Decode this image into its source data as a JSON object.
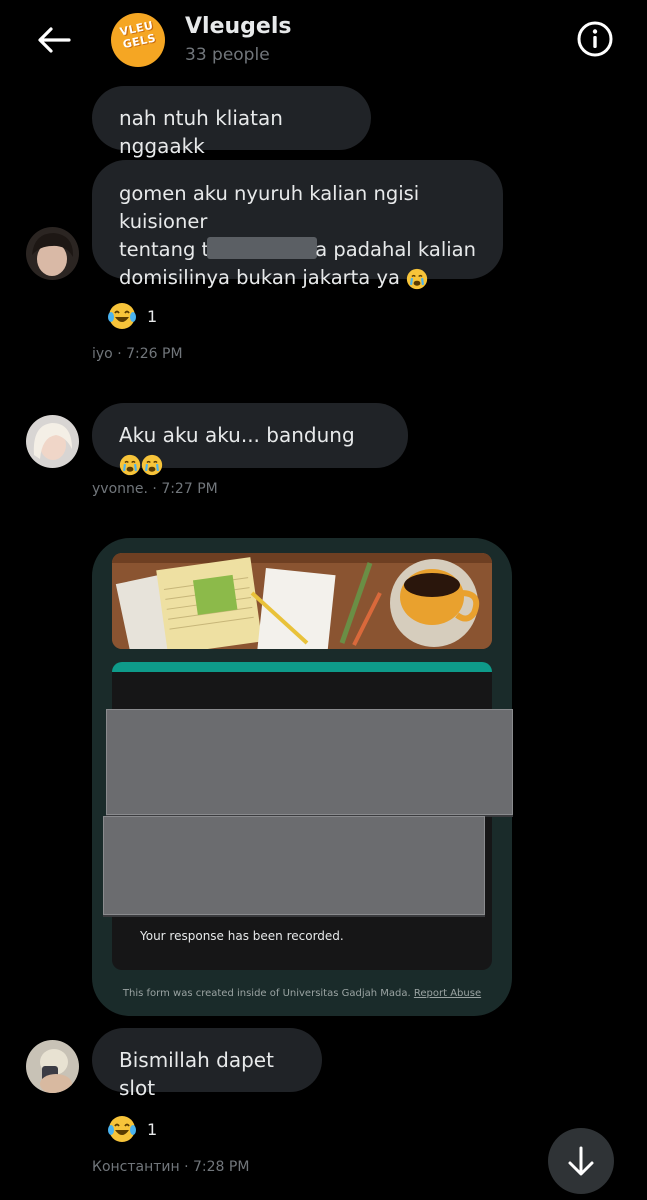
{
  "header": {
    "group_name": "Vleugels",
    "member_count": "33 people",
    "logo_text": "VLEU GELS"
  },
  "messages": [
    {
      "text": "nah ntuh kliatan nggaakk"
    },
    {
      "text_part1": "gomen aku nyuruh kalian ngisi kuisioner",
      "text_part2a": "tentang t",
      "text_part2b": "a padahal kalian",
      "text_part3": "domisilinya bukan jakarta ya",
      "reaction_count": "1",
      "sender": "iyo",
      "time": "7:26 PM"
    },
    {
      "text": "Aku aku aku... bandung",
      "sender": "yvonne.",
      "time": "7:27 PM"
    },
    {
      "text": "Bismillah dapet slot",
      "reaction_count": "1",
      "sender": "Константин",
      "time": "7:28 PM"
    }
  ],
  "form_card": {
    "recorded_text": "Your response has been recorded.",
    "footer_text": "This form was created inside of Universitas Gadjah Mada.",
    "report_link": "Report Abuse"
  },
  "colors": {
    "bubble": "#202327",
    "muted": "#71767b",
    "accent_teal": "#0e9b8a",
    "form_bg": "#1a2b2a"
  }
}
